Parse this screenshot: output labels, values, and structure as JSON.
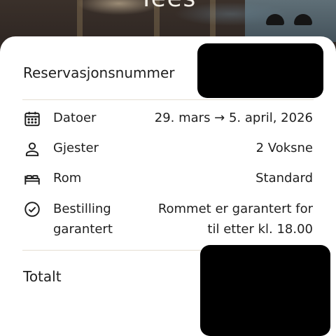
{
  "hero": {
    "title": "Tees"
  },
  "reservation": {
    "label": "Reservasjonsnummer"
  },
  "details": {
    "dates": {
      "label": "Datoer",
      "value": "29. mars → 5. april, 2026",
      "icon": "calendar-icon"
    },
    "guests": {
      "label": "Gjester",
      "value": "2 Voksne",
      "icon": "person-icon"
    },
    "room": {
      "label": "Rom",
      "value": "Standard",
      "icon": "bed-icon"
    },
    "guarantee": {
      "label_line1": "Bestilling",
      "label_line2": "garantert",
      "value_line1": "Rommet er garantert for",
      "value_line2": "til etter kl. 18.00",
      "icon": "check-circle-icon"
    }
  },
  "total": {
    "label": "Totalt"
  },
  "colors": {
    "card": "#ffffff",
    "divider": "#e4ded2",
    "text": "#1f1f1f",
    "redaction": "#000000"
  }
}
